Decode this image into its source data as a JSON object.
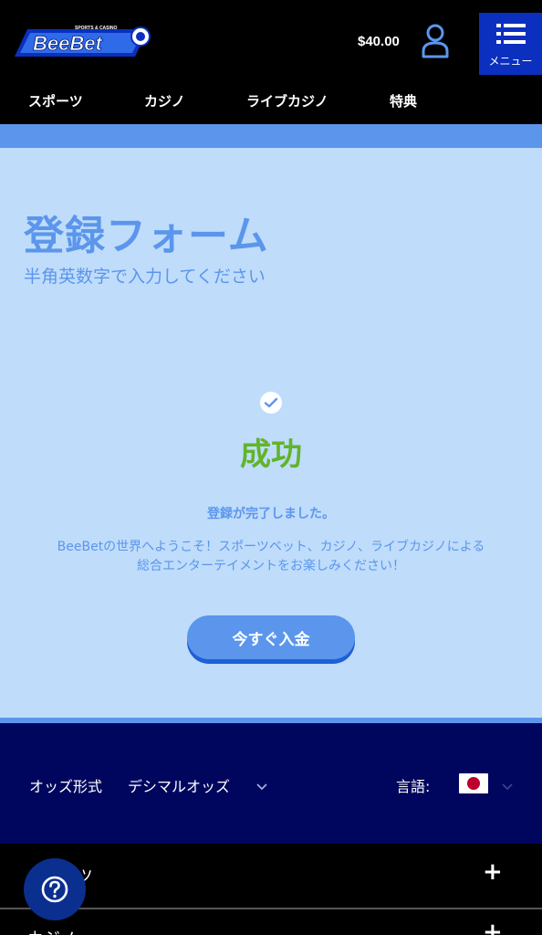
{
  "header": {
    "logo_text": "BeeBet",
    "logo_tagline": "SPORTS & CASINO",
    "balance": "$40.00",
    "menu_label": "メニュー"
  },
  "nav": {
    "items": [
      {
        "label": "スポーツ"
      },
      {
        "label": "カジノ"
      },
      {
        "label": "ライブカジノ"
      },
      {
        "label": "特典"
      }
    ]
  },
  "form": {
    "title": "登録フォーム",
    "subtitle": "半角英数字で入力してください"
  },
  "success": {
    "title": "成功",
    "message": "登録が完了しました。",
    "welcome": "BeeBetの世界へようこそ！スポーツベット、カジノ、ライブカジノによる総合エンターテイメントをお楽しみください！",
    "deposit_button": "今すぐ入金"
  },
  "footer": {
    "odds_label": "オッズ形式",
    "odds_value": "デシマルオッズ",
    "language_label": "言語:",
    "accordion": [
      {
        "label": "スポーツ"
      },
      {
        "label": "カジノ"
      }
    ]
  },
  "colors": {
    "accent": "#5b96ec",
    "success": "#62b42a",
    "menu_bg": "#0b2fbf",
    "footer_bg": "#00065e"
  }
}
